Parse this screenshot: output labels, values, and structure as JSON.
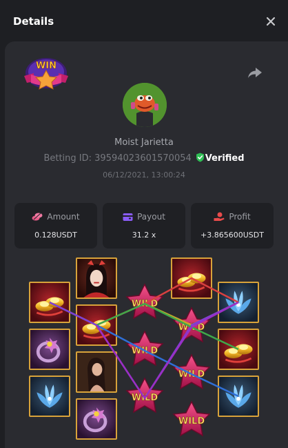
{
  "dialog": {
    "title": "Details"
  },
  "player": {
    "name": "Moist Jarietta",
    "betting_id_label": "Betting ID:",
    "betting_id": "39594023601570054",
    "verified_label": "Verified",
    "datetime": "06/12/2021, 13:00:24"
  },
  "badge": {
    "text": "WIN"
  },
  "stats": [
    {
      "label": "Amount",
      "value": "0.128USDT",
      "icon": "coins-icon",
      "color": "#e85d8a"
    },
    {
      "label": "Payout",
      "value": "31.2 x",
      "icon": "wallet-icon",
      "color": "#8a5cf5"
    },
    {
      "label": "Profit",
      "value": "+3.865600USDT",
      "icon": "profit-hand-icon",
      "color": "#e84b4b"
    }
  ],
  "reels": {
    "wild_text": "WILD",
    "columns": [
      [
        "gold-ingots",
        "purple-ring",
        "blue-lotus"
      ],
      [
        "geisha",
        "gold-ingots",
        "lady",
        "purple-ring"
      ],
      [
        "wild",
        "wild",
        "wild"
      ],
      [
        "gold-ingots",
        "wild",
        "wild",
        "wild"
      ],
      [
        "blue-lotus",
        "gold-ingots",
        "blue-lotus"
      ]
    ],
    "payline_colors": [
      "#7b3fd6",
      "#d94040",
      "#3fa84a",
      "#2f6fd6",
      "#c8a62a",
      "#9b2fc4"
    ]
  }
}
